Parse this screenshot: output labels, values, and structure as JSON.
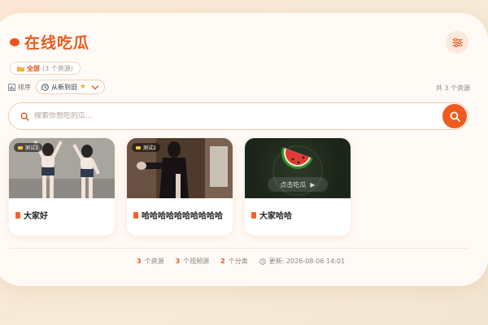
{
  "app": {
    "title": "在线吃瓜"
  },
  "filter": {
    "all_label": "全部",
    "all_count": "(3 个资源)"
  },
  "sort": {
    "label": "排序",
    "value": "从新到旧"
  },
  "summary": {
    "total": "共 3 个资源"
  },
  "search": {
    "placeholder": "搜索你想吃的瓜..."
  },
  "cards": [
    {
      "tag": "测试2",
      "title": "大家好"
    },
    {
      "tag": "测试2",
      "title": "哈哈哈哈哈哈哈哈哈哈"
    },
    {
      "overlay": "点击吃瓜",
      "title": "大家哈哈"
    }
  ],
  "footer": {
    "resources_num": "3",
    "resources_label": "个资源",
    "videos_num": "3",
    "videos_label": "个视频源",
    "categories_num": "2",
    "categories_label": "个分类",
    "updated": "更新: 2026-08-06 14:01"
  },
  "colors": {
    "accent": "#f05a1d",
    "panel": "#fffaf6"
  }
}
